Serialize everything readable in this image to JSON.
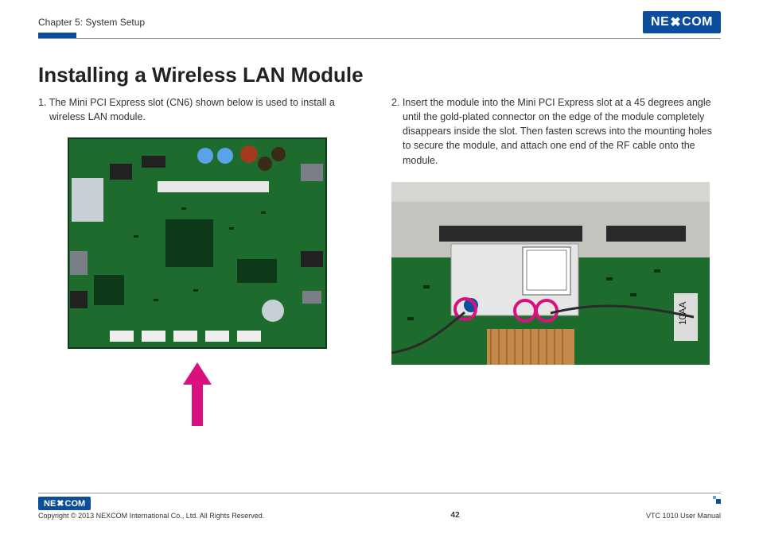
{
  "header": {
    "chapter": "Chapter 5: System Setup",
    "logo_text": "NE COM",
    "logo_x": "X"
  },
  "page": {
    "title": "Installing a Wireless LAN Module"
  },
  "steps": {
    "step1": "1. The Mini PCI Express slot (CN6) shown below is used to install a wireless LAN module.",
    "step2": "2. Insert the module into the Mini PCI Express slot at a 45 degrees angle until the gold-plated connector on the edge of the module completely disappears inside the slot. Then fasten screws into the mounting holes to secure the module, and attach one end of the RF cable onto the module."
  },
  "footer": {
    "logo_text": "NE COM",
    "logo_x": "X",
    "copyright": "Copyright © 2013 NEXCOM International Co., Ltd. All Rights Reserved.",
    "page_number": "42",
    "manual": "VTC 1010 User Manual"
  }
}
